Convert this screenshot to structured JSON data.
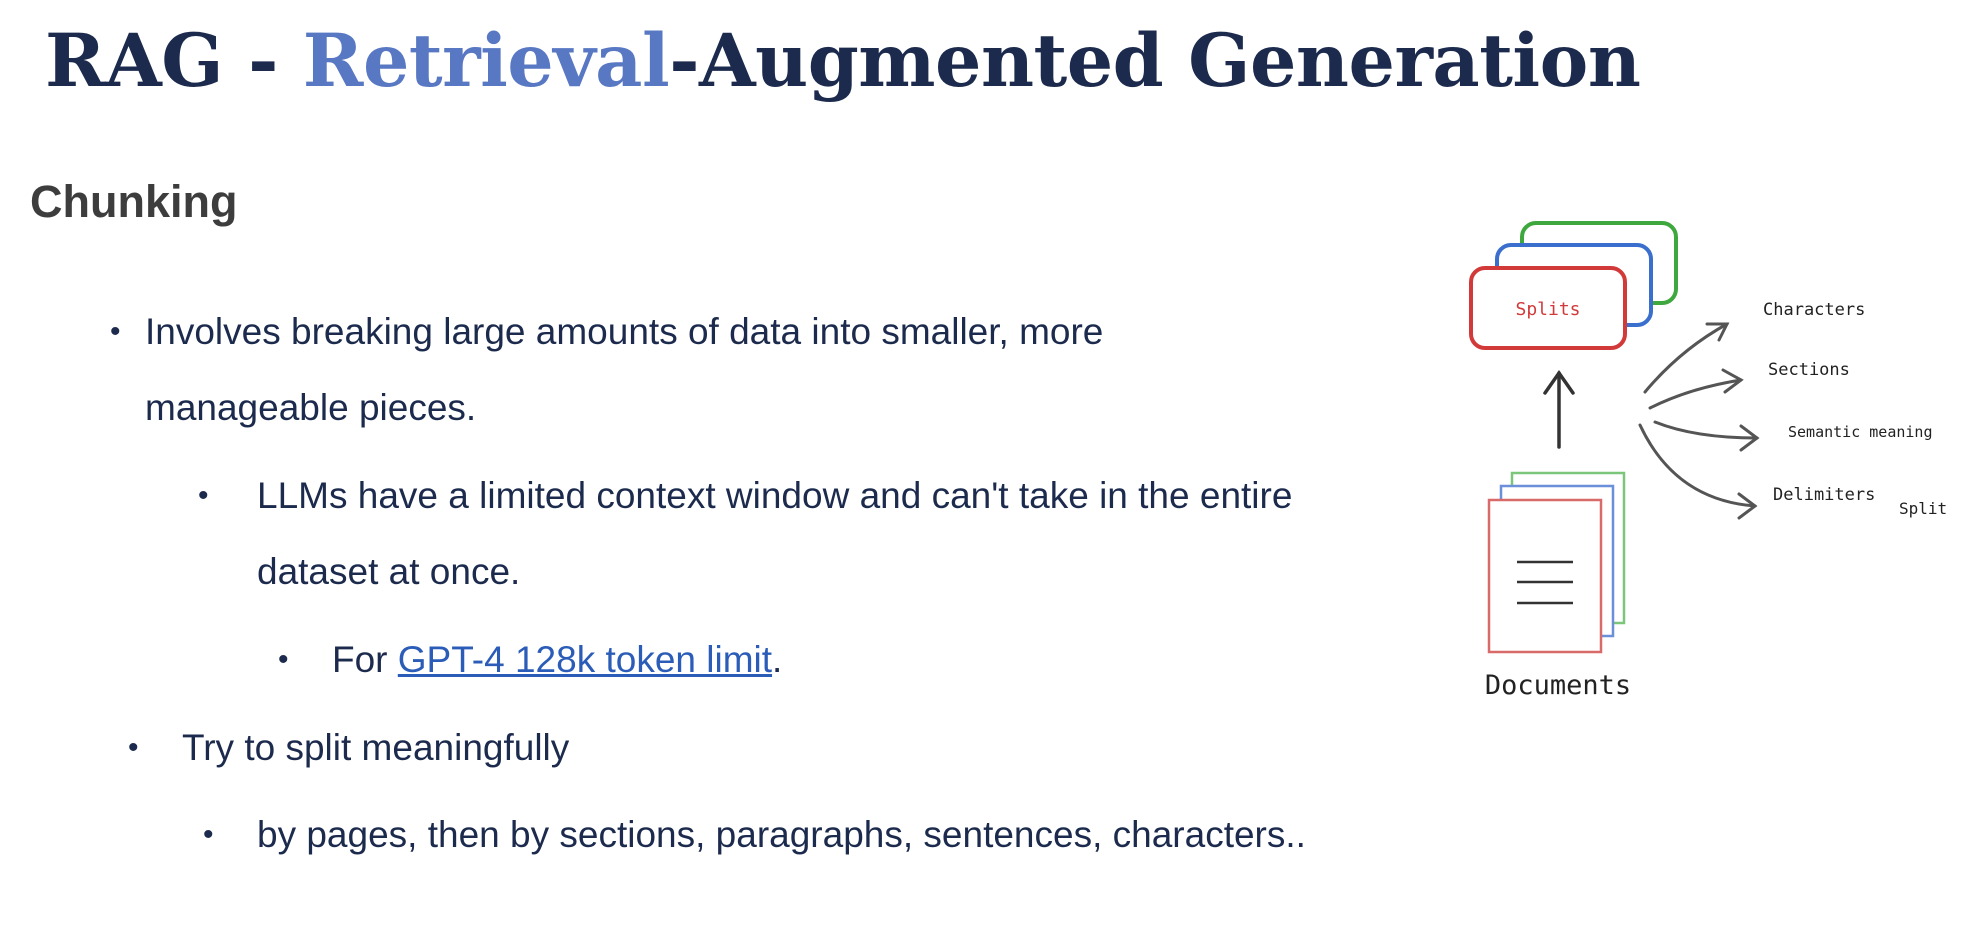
{
  "slide": {
    "title": {
      "part1": "RAG - ",
      "accent": "Retrieval",
      "part2": "-Augmented Generation",
      "accent_color": "#5878c3",
      "color": "#1c2b4d"
    },
    "subtitle": "Chunking",
    "bullets": {
      "b1_line1": "Involves breaking large amounts of data into smaller, more",
      "b1_line2": "manageable pieces.",
      "b2_line1": "LLMs have a limited context window and can't take in the entire",
      "b2_line2": "dataset at once.",
      "b3_prefix": "For ",
      "b3_link": "GPT-4 128k token limit",
      "b3_suffix": ".",
      "b4": "Try to split meaningfully",
      "b5": "by pages, then by sections, paragraphs, sentences, characters.."
    },
    "bullet_glyph": "•",
    "link_color": "#2b5db8"
  },
  "diagram": {
    "splits_label": "Splits",
    "documents_label": "Documents",
    "targets": [
      "Characters",
      "Sections",
      "Semantic meaning",
      "Delimiters"
    ],
    "split_label": "Split"
  }
}
